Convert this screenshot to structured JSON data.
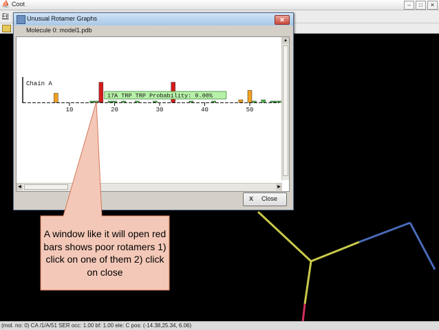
{
  "coot": {
    "title": "Coot",
    "menu_file": "Fil",
    "status_text": "(mol. no: 0)  CA  /1/A/51 SER occ:  1.00 bf:  1.00 ele:  C pos: (-14.38,25.34, 6.06)"
  },
  "dialog": {
    "title": "Unusual Rotamer Graphs",
    "molecule_label": "Molecule 0: model1.pdb",
    "close_label": "Close",
    "close_x": "x"
  },
  "chart_data": {
    "type": "bar",
    "chain_label": "Chain A",
    "x_ticks": [
      10,
      20,
      30,
      40,
      50
    ],
    "tooltip": "17A TRP  TRP Probability:  0.00%",
    "colors": {
      "bad": "#d41c1c",
      "warn": "#f0a020",
      "ok": "#44bb44"
    },
    "bars": [
      {
        "res": 7,
        "level": 0.42,
        "color": "warn"
      },
      {
        "res": 15,
        "level": 0.04,
        "color": "ok"
      },
      {
        "res": 16,
        "level": 0.05,
        "color": "ok"
      },
      {
        "res": 17,
        "level": 0.92,
        "color": "bad"
      },
      {
        "res": 19,
        "level": 0.04,
        "color": "ok"
      },
      {
        "res": 20,
        "level": 0.03,
        "color": "ok"
      },
      {
        "res": 22,
        "level": 0.03,
        "color": "ok"
      },
      {
        "res": 25,
        "level": 0.02,
        "color": "ok"
      },
      {
        "res": 29,
        "level": 0.03,
        "color": "ok"
      },
      {
        "res": 33,
        "level": 0.92,
        "color": "bad"
      },
      {
        "res": 37,
        "level": 0.03,
        "color": "ok"
      },
      {
        "res": 42,
        "level": 0.02,
        "color": "ok"
      },
      {
        "res": 48,
        "level": 0.12,
        "color": "warn"
      },
      {
        "res": 50,
        "level": 0.55,
        "color": "warn"
      },
      {
        "res": 51,
        "level": 0.04,
        "color": "ok"
      },
      {
        "res": 53,
        "level": 0.12,
        "color": "ok"
      },
      {
        "res": 55,
        "level": 0.05,
        "color": "ok"
      },
      {
        "res": 56,
        "level": 0.05,
        "color": "ok"
      },
      {
        "res": 57,
        "level": 0.05,
        "color": "ok"
      }
    ]
  },
  "annotation": {
    "text": "A window like it will open red bars shows poor rotamers 1) click on one of them 2) click on close"
  }
}
